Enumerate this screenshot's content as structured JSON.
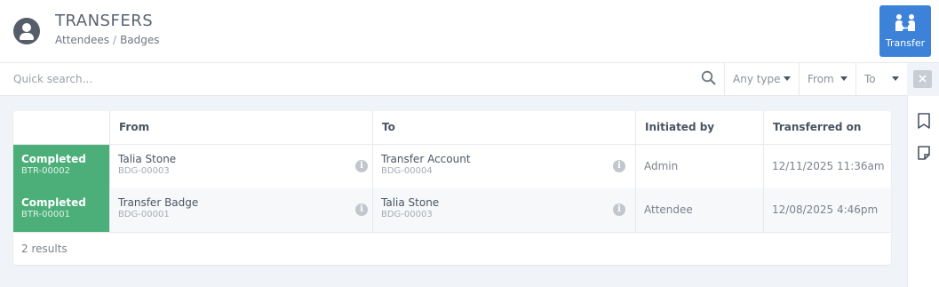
{
  "header": {
    "title": "TRANSFERS",
    "breadcrumb": [
      "Attendees",
      "Badges"
    ],
    "breadcrumb_separator": "/",
    "transfer_button_label": "Transfer"
  },
  "filters": {
    "search_placeholder": "Quick search...",
    "type_label": "Any type",
    "from_label": "From",
    "to_label": "To"
  },
  "table": {
    "columns": [
      "",
      "From",
      "To",
      "Initiated by",
      "Transferred on"
    ],
    "rows": [
      {
        "status": "Completed",
        "id": "BTR-00002",
        "from_name": "Talia Stone",
        "from_badge": "BDG-00003",
        "to_name": "Transfer Account",
        "to_badge": "BDG-00004",
        "initiated_by": "Admin",
        "transferred_on": "12/11/2025 11:36am"
      },
      {
        "status": "Completed",
        "id": "BTR-00001",
        "from_name": "Transfer Badge",
        "from_badge": "BDG-00001",
        "to_name": "Talia Stone",
        "to_badge": "BDG-00003",
        "initiated_by": "Attendee",
        "transferred_on": "12/08/2025 4:46pm"
      }
    ],
    "results_text": "2 results"
  },
  "colors": {
    "accent": "#3b82d8",
    "status_completed": "#4caf79"
  },
  "icons": [
    "user-icon",
    "transfer-icon",
    "search-icon",
    "caret-down-icon",
    "close-icon",
    "bookmark-icon",
    "note-icon",
    "info-icon"
  ]
}
